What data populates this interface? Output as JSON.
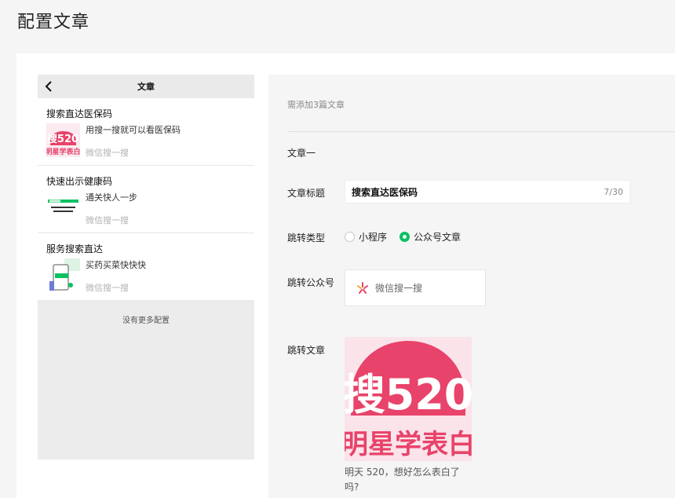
{
  "page": {
    "title": "配置文章"
  },
  "preview": {
    "header_title": "文章",
    "articles": [
      {
        "title": "搜索直达医保码",
        "desc": "用搜一搜就可以看医保码",
        "source": "微信搜一搜",
        "thumb": "cover-520"
      },
      {
        "title": "快速出示健康码",
        "desc": "通关快人一步",
        "source": "微信搜一搜",
        "thumb": "health-code"
      },
      {
        "title": "服务搜索直达",
        "desc": "买药买菜快快快",
        "source": "微信搜一搜",
        "thumb": "service-phone"
      }
    ],
    "no_more": "没有更多配置"
  },
  "form": {
    "hint": "需添加3篇文章",
    "section_title": "文章一",
    "title_label": "文章标题",
    "title_value": "搜索直达医保码",
    "title_count": "7/30",
    "type_label": "跳转类型",
    "type_options": [
      {
        "label": "小程序",
        "selected": false
      },
      {
        "label": "公众号文章",
        "selected": true
      }
    ],
    "account_label": "跳转公众号",
    "account_name": "微信搜一搜",
    "article_label": "跳转文章",
    "article_caption": "明天 520，想好怎么表白了吗?"
  },
  "colors": {
    "accent": "#07c160",
    "brand_pink": "#e8436a"
  }
}
